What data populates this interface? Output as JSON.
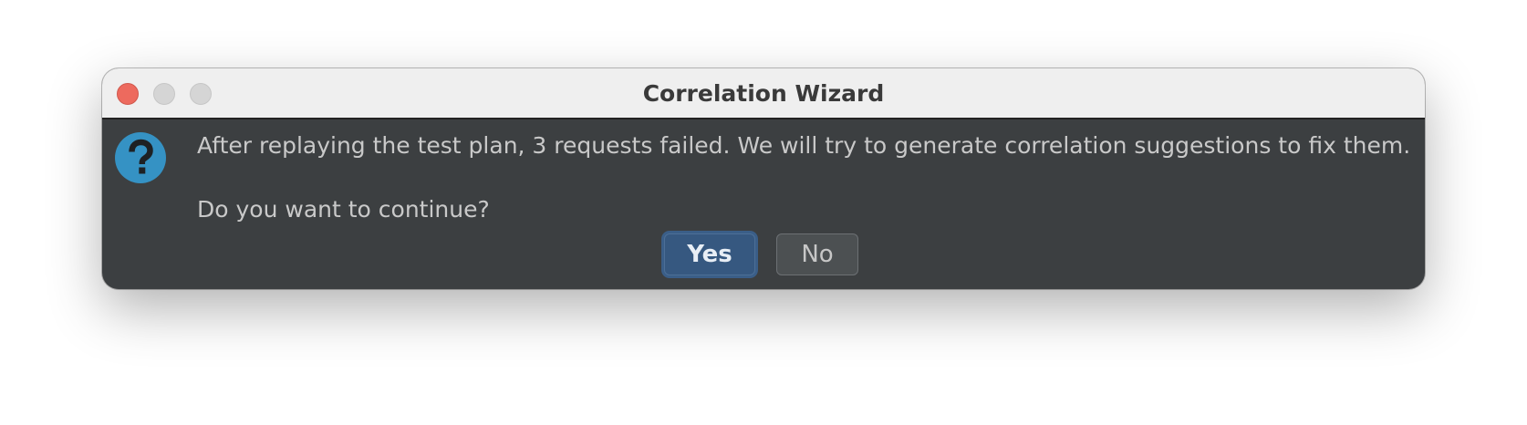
{
  "window": {
    "title": "Correlation Wizard"
  },
  "dialog": {
    "icon": "question-icon",
    "message_line1": "After replaying the test plan, 3 requests failed. We will try to generate correlation suggestions to fix them.",
    "message_line2": "Do you want to continue?"
  },
  "buttons": {
    "yes_label": "Yes",
    "no_label": "No"
  },
  "colors": {
    "dialog_background": "#3c3f41",
    "titlebar_background": "#efefef",
    "close_button": "#ed6a5e",
    "icon_blue": "#3592c4",
    "default_button": "#365880",
    "secondary_button": "#4c5052"
  }
}
